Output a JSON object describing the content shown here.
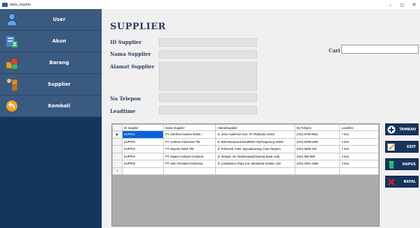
{
  "window": {
    "title": "data_master",
    "minimize": "–",
    "maximize": "◻",
    "close": "✕"
  },
  "sidebar": {
    "items": [
      {
        "label": "User",
        "icon": "user-icon"
      },
      {
        "label": "Akun",
        "icon": "account-icon"
      },
      {
        "label": "Barang",
        "icon": "goods-icon"
      },
      {
        "label": "Supplier",
        "icon": "supplier-icon"
      },
      {
        "label": "Kembali",
        "icon": "back-icon"
      }
    ]
  },
  "form": {
    "heading": "SUPPLIER",
    "id_label": "ID Supplier",
    "nama_label": "Nama Supplier",
    "alamat_label": "Alamat Supplier",
    "telepon_label": "No Telepon",
    "leadtime_label": "Leadtime",
    "cari_label": "Cari",
    "id_value": "",
    "nama_value": "",
    "alamat_value": "",
    "telepon_value": "",
    "leadtime_value": "",
    "cari_value": ""
  },
  "table": {
    "headers": [
      "ID Supplier",
      "Nama Supplier",
      "AlamatSupplier",
      "No Telepon",
      "Leadtime"
    ],
    "current_row_marker": "▶",
    "new_row_marker": "*",
    "rows": [
      [
        "SUPP01",
        "PT. Indofood Sukses Makm...",
        "Jl. Jend. Sudirman Kav. 76-78Jakarta 12910",
        "(021) 5795 8822",
        "7 hari"
      ],
      [
        "SUPP02",
        "PT. Unilever Indonesia Tbk",
        "Jl. BSD Boulevard BaratBSD CityTangerang 15345",
        "(021) 5299 5299",
        "2 hari"
      ],
      [
        "SUPP03",
        "PT. Mayora Indah Tbk",
        "Jl. Telesonik, Pasir JayaJatiuwung, Kota Tangera",
        "(021) 5655 333",
        "1 hari"
      ],
      [
        "SUPP04",
        "PT. Nippon Indosari Corpindo",
        "Jl. Selayar, A9, MekarwangiCikarang Barat, Kab.",
        "(021) 890 989",
        "2 hari"
      ],
      [
        "SUPP05",
        "PT. ABC President Indonesia",
        "Jl. Casablanca Raya Kav. 88Jakarta Selatan 128",
        "(021) 2901 0288",
        "3 hari"
      ]
    ]
  },
  "buttons": {
    "tambah": "TAMBAH",
    "edit": "EDIT",
    "hapus": "HAPUS",
    "batal": "BATAL"
  },
  "colors": {
    "sidebar_bg": "#16355e",
    "nav_item_bg": "#3a5a80",
    "heading": "#2b3e5b",
    "selected_row": "#0a64d8"
  }
}
